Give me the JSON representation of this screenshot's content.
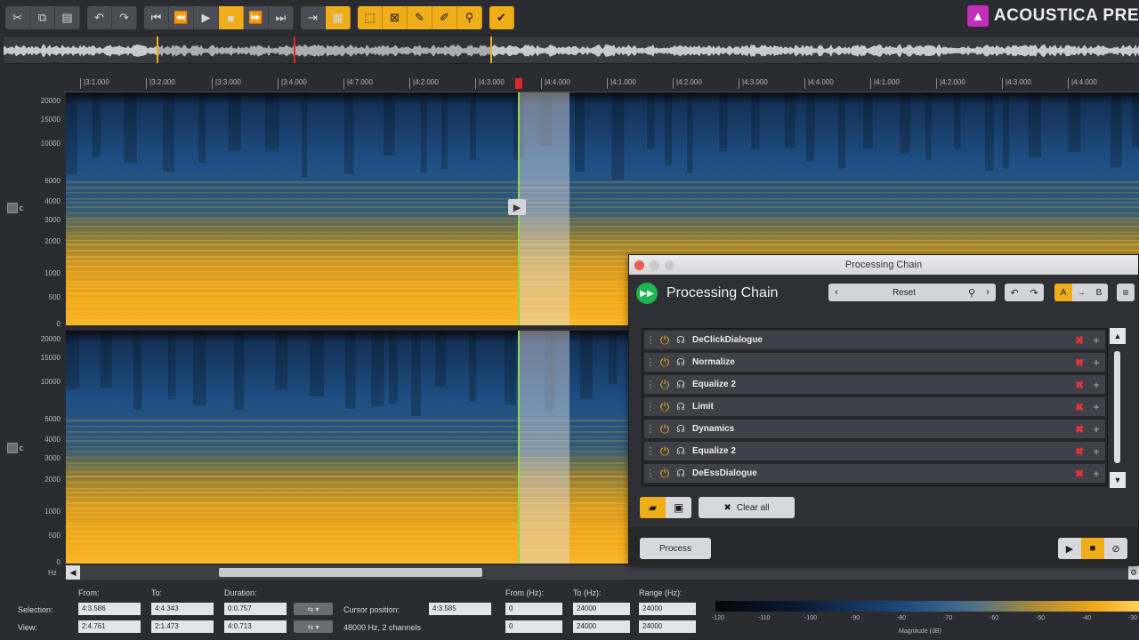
{
  "brand": {
    "logo_glyph": "▲",
    "name": "ACOUSTICA PRE"
  },
  "toolbar": {
    "groups": [
      {
        "style": "gray",
        "buttons": [
          {
            "name": "cut-icon",
            "glyph": "✂"
          },
          {
            "name": "copy-icon",
            "glyph": "⧉"
          },
          {
            "name": "paste-icon",
            "glyph": "▤"
          }
        ]
      },
      {
        "style": "gray",
        "buttons": [
          {
            "name": "undo-icon",
            "glyph": "↶",
            "dim": true
          },
          {
            "name": "redo-icon",
            "glyph": "↷",
            "dim": true
          }
        ]
      },
      {
        "style": "gray",
        "buttons": [
          {
            "name": "skip-start-icon",
            "glyph": "⏮"
          },
          {
            "name": "rewind-icon",
            "glyph": "⏪"
          },
          {
            "name": "play-icon",
            "glyph": "▶"
          },
          {
            "name": "stop-icon",
            "glyph": "■",
            "on": true
          },
          {
            "name": "fast-forward-icon",
            "glyph": "⏩"
          },
          {
            "name": "skip-end-icon",
            "glyph": "⏭"
          }
        ]
      },
      {
        "style": "gray",
        "buttons": [
          {
            "name": "loop-icon",
            "glyph": "⇥"
          },
          {
            "name": "spectrum-view-icon",
            "glyph": "▦",
            "on": true
          }
        ]
      },
      {
        "style": "yellow",
        "buttons": [
          {
            "name": "select-tool-icon",
            "glyph": "⬚"
          },
          {
            "name": "region-select-icon",
            "glyph": "⊠"
          },
          {
            "name": "brush-tool-icon",
            "glyph": "✎"
          },
          {
            "name": "pen-tool-icon",
            "glyph": "✐"
          },
          {
            "name": "zoom-tool-icon",
            "glyph": "⚲"
          }
        ]
      },
      {
        "style": "yellow",
        "buttons": [
          {
            "name": "snap-icon",
            "glyph": "✔"
          }
        ]
      }
    ]
  },
  "ruler": {
    "ticks": [
      "|3:1.000",
      "|3:2.000",
      "|3:3.000",
      "|3:4.000",
      "|4:7.000",
      "|4:2.000",
      "|4:3.000",
      "|4:4.000",
      "|4:1.000",
      "|4:2.000",
      "|4:3.000",
      "|4:4.000",
      "|4:1.000",
      "|4:2.000",
      "|4:3.000",
      "|4:4.000"
    ]
  },
  "freq_axis": [
    "20000",
    "15000",
    "10000",
    "6000",
    "4000",
    "3000",
    "2000",
    "1000",
    "500",
    "0"
  ],
  "freq_unit": "Hz",
  "scrollbar": {
    "left": "◀",
    "right": "⚙"
  },
  "info": {
    "labels": {
      "from": "From:",
      "to": "To:",
      "duration": "Duration:",
      "cursor": "Cursor position:",
      "from_hz": "From (Hz):",
      "to_hz": "To (Hz):",
      "range_hz": "Range (Hz):"
    },
    "selection_label": "Selection:",
    "view_label": "View:",
    "selection": {
      "from": "4:3.586",
      "to": "4:4.343",
      "duration": "0:0.757"
    },
    "view": {
      "from": "2:4.761",
      "to": "2:1.473",
      "duration": "4:0.713"
    },
    "cursor_position": "4:3.585",
    "format": "48000 Hz, 2 channels",
    "selection_hz": {
      "from": "0",
      "to": "24000",
      "range": "24000"
    },
    "view_hz": {
      "from": "0",
      "to": "24000",
      "range": "24000"
    },
    "button_label": "⇆  ▾"
  },
  "colorbar": {
    "ticks": [
      "-120",
      "-110",
      "-100",
      "-90",
      "-80",
      "-70",
      "-60",
      "-50",
      "-40",
      "-30"
    ],
    "title": "Magnitude (dB)"
  },
  "processing_chain": {
    "window_title": "Processing Chain",
    "heading": "Processing Chain",
    "preset": "Reset",
    "ab": {
      "a": "A",
      "arrow": "→",
      "b": "B"
    },
    "plugins": [
      "DeClickDialogue",
      "Normalize",
      "Equalize 2",
      "Limit",
      "Dynamics",
      "Equalize 2",
      "DeEssDialogue"
    ],
    "clear_all": "Clear all",
    "process": "Process"
  },
  "colors": {
    "accent": "#f0ad1a",
    "spectrogram_low": "#1f4a7e",
    "spectrogram_high": "#f2a81a",
    "cursor": "#8fd84a",
    "playhead": "#e0262a"
  }
}
